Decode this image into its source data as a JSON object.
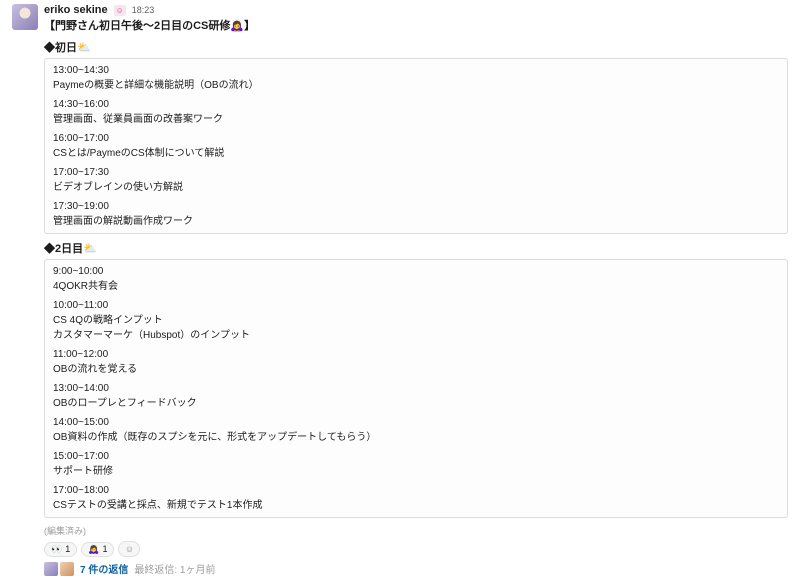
{
  "message": {
    "author": "eriko sekine",
    "badge": "☺",
    "timestamp": "18:23",
    "title": "【門野さん初日午後～2日目のCS研修🙇‍♀️】",
    "edited_label": "(編集済み)"
  },
  "sections": [
    {
      "label": "◆初日⛅",
      "items": [
        {
          "time": "13:00~14:30",
          "desc": "Paymeの概要と詳細な機能説明（OBの流れ）"
        },
        {
          "time": "14:30~16:00",
          "desc": "管理画面、従業員画面の改善案ワーク"
        },
        {
          "time": "16:00~17:00",
          "desc": "CSとは/PaymeのCS体制について解説"
        },
        {
          "time": "17:00~17:30",
          "desc": "ビデオブレインの使い方解説"
        },
        {
          "time": "17:30~19:00",
          "desc": "管理画面の解説動画作成ワーク"
        }
      ]
    },
    {
      "label": "◆2日目⛅",
      "items": [
        {
          "time": "9:00~10:00",
          "desc": "4QOKR共有会"
        },
        {
          "time": "10:00~11:00",
          "desc": "CS 4Qの戦略インプット\nカスタマーマーケ（Hubspot）のインプット"
        },
        {
          "time": "11:00~12:00",
          "desc": "OBの流れを覚える"
        },
        {
          "time": "13:00~14:00",
          "desc": "OBのロープレとフィードバック"
        },
        {
          "time": "14:00~15:00",
          "desc": "OB資料の作成（既存のスプシを元に、形式をアップデートしてもらう）"
        },
        {
          "time": "15:00~17:00",
          "desc": "サポート研修"
        },
        {
          "time": "17:00~18:00",
          "desc": "CSテストの受講と採点、新規でテスト1本作成"
        }
      ]
    }
  ],
  "reactions": [
    {
      "emoji": "👀",
      "count": "1"
    },
    {
      "emoji": "🙇‍♀️",
      "count": "1"
    }
  ],
  "add_reaction_icon": "☺",
  "thread": {
    "replies_label": "7 件の返信",
    "last_reply_label": "最終返信: 1ヶ月前"
  }
}
